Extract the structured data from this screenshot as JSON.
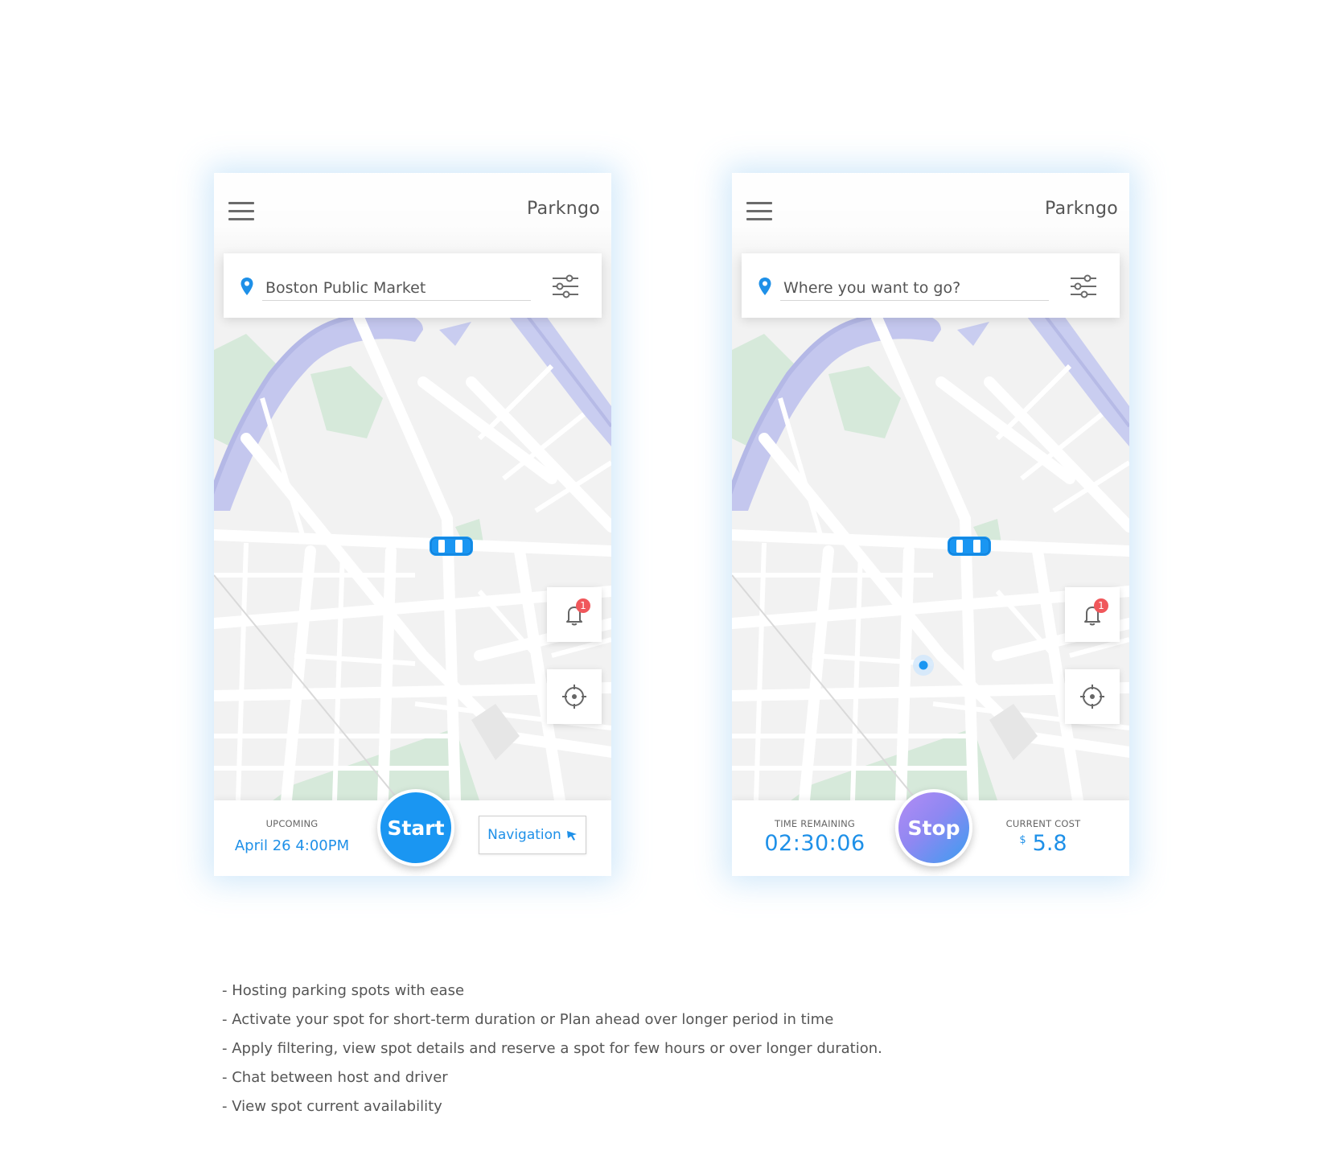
{
  "screens": [
    {
      "app_title": "Parkngo",
      "search_value": "Boston Public Market",
      "search_placeholder": "",
      "notification_count": "1",
      "bottom": {
        "left_label": "UPCOMING",
        "left_value": "April 26 4:00PM",
        "center_button": "Start",
        "right_button": "Navigation"
      }
    },
    {
      "app_title": "Parkngo",
      "search_value": "",
      "search_placeholder": "Where you want to go?",
      "notification_count": "1",
      "bottom": {
        "left_label": "TIME REMAINING",
        "left_value": "02:30:06",
        "center_button": "Stop",
        "right_label": "CURRENT COST",
        "currency": "$",
        "right_value": "5.8"
      }
    }
  ],
  "features": [
    "- Hosting parking spots with ease",
    "- Activate your spot for short-term duration or Plan ahead over longer period in time",
    "- Apply filtering, view spot details and reserve a spot for few hours or over longer duration.",
    "- Chat between host and driver",
    "- View spot current availability"
  ],
  "icons": {
    "menu": "hamburger-icon",
    "pin": "location-pin-icon",
    "filter": "filter-sliders-icon",
    "car": "car-icon",
    "bell": "bell-icon",
    "locate": "crosshair-icon",
    "navigate": "cursor-arrow-icon"
  },
  "colors": {
    "accent": "#1e90e8",
    "start_button": "#1a96f2",
    "stop_gradient": [
      "#b38bf4",
      "#3b9df0"
    ],
    "badge": "#f0575b",
    "map_background": "#f2f2f2",
    "map_water": "#bfc3ec",
    "map_park": "#d5e8d9"
  }
}
